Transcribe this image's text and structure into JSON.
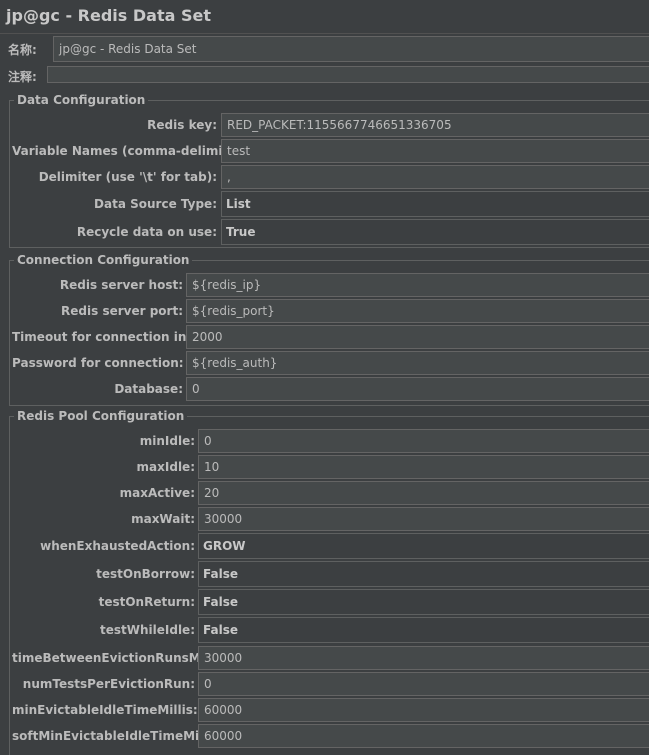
{
  "window": {
    "title": "jp@gc - Redis Data Set"
  },
  "header": {
    "name_label": "名称:",
    "name_value": "jp@gc - Redis Data Set",
    "comment_label": "注释:",
    "comment_value": ""
  },
  "data_config": {
    "legend": "Data Configuration",
    "redis_key_label": "Redis key:",
    "redis_key_value": "RED_PACKET:1155667746651336705",
    "var_names_label": "Variable Names (comma-delimited):",
    "var_names_value": "test",
    "delimiter_label": "Delimiter (use '\\t' for tab):",
    "delimiter_value": ",",
    "data_source_label": "Data Source Type:",
    "data_source_value": "List",
    "recycle_label": "Recycle data on use:",
    "recycle_value": "True"
  },
  "connection_config": {
    "legend": "Connection Configuration",
    "host_label": "Redis server host:",
    "host_value": "${redis_ip}",
    "port_label": "Redis server port:",
    "port_value": "${redis_port}",
    "timeout_label": "Timeout for connection in ms:",
    "timeout_value": "2000",
    "password_label": "Password for connection:",
    "password_value": "${redis_auth}",
    "database_label": "Database:",
    "database_value": "0"
  },
  "pool_config": {
    "legend": "Redis Pool Configuration",
    "min_idle_label": "minIdle:",
    "min_idle_value": "0",
    "max_idle_label": "maxIdle:",
    "max_idle_value": "10",
    "max_active_label": "maxActive:",
    "max_active_value": "20",
    "max_wait_label": "maxWait:",
    "max_wait_value": "30000",
    "when_exhausted_label": "whenExhaustedAction:",
    "when_exhausted_value": "GROW",
    "test_on_borrow_label": "testOnBorrow:",
    "test_on_borrow_value": "False",
    "test_on_return_label": "testOnReturn:",
    "test_on_return_value": "False",
    "test_while_idle_label": "testWhileIdle:",
    "test_while_idle_value": "False",
    "time_between_label": "timeBetweenEvictionRunsMillis:",
    "time_between_value": "30000",
    "num_tests_label": "numTestsPerEvictionRun:",
    "num_tests_value": "0",
    "min_evictable_label": "minEvictableIdleTimeMillis:",
    "min_evictable_value": "60000",
    "soft_min_evictable_label": "softMinEvictableIdleTimeMillis:",
    "soft_min_evictable_value": "60000"
  }
}
